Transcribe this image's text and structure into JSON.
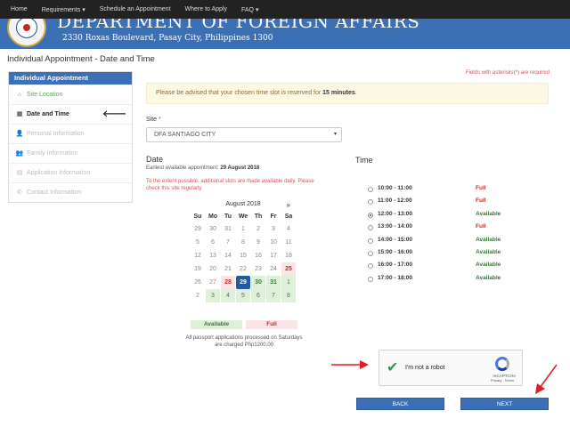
{
  "nav": [
    "Home",
    "Requirements ▾",
    "Schedule an Appointment",
    "Where to Apply",
    "FAQ ▾"
  ],
  "header": {
    "title": "DEPARTMENT OF FOREIGN AFFAIRS",
    "address": "2330 Roxas Boulevard, Pasay City, Philippines 1300"
  },
  "page_title": "Individual Appointment - Date and Time",
  "sidebar": {
    "heading": "Individual Appointment",
    "items": [
      {
        "label": "Site Location",
        "icon": "home-icon",
        "glyph": "⌂",
        "state": "done"
      },
      {
        "label": "Date and Time",
        "icon": "calendar-icon",
        "glyph": "▦",
        "state": "active"
      },
      {
        "label": "Personal Information",
        "icon": "user-icon",
        "glyph": "👤",
        "state": "disabled"
      },
      {
        "label": "Family Information",
        "icon": "users-icon",
        "glyph": "👥",
        "state": "disabled"
      },
      {
        "label": "Application Information",
        "icon": "document-icon",
        "glyph": "▤",
        "state": "disabled"
      },
      {
        "label": "Contact Information",
        "icon": "phone-icon",
        "glyph": "✆",
        "state": "disabled"
      }
    ],
    "active_arrow": "🡐"
  },
  "required_note": "Fields with asterisks(*) are required",
  "alert": {
    "prefix": "Please be advised that your chosen time slot is reserved for ",
    "emphasis": "15 minutes",
    "suffix": "."
  },
  "site": {
    "label": "Site",
    "required_mark": "*",
    "value": "DFA SANTIAGO CITY",
    "caret": "▾"
  },
  "date": {
    "heading": "Date",
    "earliest_prefix": "Earliest available appointment: ",
    "earliest_value": "29 August 2018",
    "extent_note": "To the extent possible, additional slots are made available daily. Please check this site regularly."
  },
  "calendar": {
    "month": "August 2018",
    "next": "»",
    "weekdays": [
      "Su",
      "Mo",
      "Tu",
      "We",
      "Th",
      "Fr",
      "Sa"
    ],
    "weeks": [
      [
        {
          "d": "29",
          "s": "muted"
        },
        {
          "d": "30",
          "s": "muted"
        },
        {
          "d": "31",
          "s": "muted"
        },
        {
          "d": "1",
          "s": "muted"
        },
        {
          "d": "2",
          "s": "muted"
        },
        {
          "d": "3",
          "s": "muted"
        },
        {
          "d": "4",
          "s": "muted"
        }
      ],
      [
        {
          "d": "5",
          "s": "muted"
        },
        {
          "d": "6",
          "s": "muted"
        },
        {
          "d": "7",
          "s": "muted"
        },
        {
          "d": "8",
          "s": "muted"
        },
        {
          "d": "9",
          "s": "muted"
        },
        {
          "d": "10",
          "s": "muted"
        },
        {
          "d": "11",
          "s": "muted"
        }
      ],
      [
        {
          "d": "12",
          "s": "muted"
        },
        {
          "d": "13",
          "s": "muted"
        },
        {
          "d": "14",
          "s": "muted"
        },
        {
          "d": "15",
          "s": "muted"
        },
        {
          "d": "16",
          "s": "muted"
        },
        {
          "d": "17",
          "s": "muted"
        },
        {
          "d": "18",
          "s": "muted"
        }
      ],
      [
        {
          "d": "19",
          "s": "muted"
        },
        {
          "d": "20",
          "s": "muted"
        },
        {
          "d": "21",
          "s": "muted"
        },
        {
          "d": "22",
          "s": "muted"
        },
        {
          "d": "23",
          "s": "muted"
        },
        {
          "d": "24",
          "s": "muted"
        },
        {
          "d": "25",
          "s": "full"
        }
      ],
      [
        {
          "d": "26",
          "s": "muted"
        },
        {
          "d": "27",
          "s": "muted"
        },
        {
          "d": "28",
          "s": "full"
        },
        {
          "d": "29",
          "s": "selected"
        },
        {
          "d": "30",
          "s": "avail"
        },
        {
          "d": "31",
          "s": "avail"
        },
        {
          "d": "1",
          "s": "next-month"
        }
      ],
      [
        {
          "d": "2",
          "s": "muted"
        },
        {
          "d": "3",
          "s": "next-month"
        },
        {
          "d": "4",
          "s": "next-month"
        },
        {
          "d": "5",
          "s": "next-month"
        },
        {
          "d": "6",
          "s": "next-month"
        },
        {
          "d": "7",
          "s": "next-month"
        },
        {
          "d": "8",
          "s": "next-month"
        }
      ]
    ],
    "legend_available": "Available",
    "legend_full": "Full",
    "saturday_note": "All passport applications processed on Saturdays are charged Php1200.00"
  },
  "time": {
    "heading": "Time",
    "slots": [
      {
        "range": "10:00 - 11:00",
        "status": "Full",
        "kind": "full",
        "checked": false
      },
      {
        "range": "11:00 - 12:00",
        "status": "Full",
        "kind": "full",
        "checked": false
      },
      {
        "range": "12:00 - 13:00",
        "status": "Available",
        "kind": "available",
        "checked": true
      },
      {
        "range": "13:00 - 14:00",
        "status": "Full",
        "kind": "full",
        "checked": false
      },
      {
        "range": "14:00 - 15:00",
        "status": "Available",
        "kind": "available",
        "checked": false
      },
      {
        "range": "15:00 - 16:00",
        "status": "Available",
        "kind": "available",
        "checked": false
      },
      {
        "range": "16:00 - 17:00",
        "status": "Available",
        "kind": "available",
        "checked": false
      },
      {
        "range": "17:00 - 18:00",
        "status": "Available",
        "kind": "available",
        "checked": false
      }
    ]
  },
  "captcha": {
    "label": "I'm not a robot",
    "brand": "reCAPTCHA",
    "terms": "Privacy - Terms",
    "checked": true
  },
  "buttons": {
    "back": "BACK",
    "next": "NEXT"
  },
  "colors": {
    "brand_blue": "#3b6fb6",
    "navbar": "#222222",
    "available_green": "#3c763d",
    "full_red": "#c62828",
    "annotation_arrow": "#e31b23"
  }
}
